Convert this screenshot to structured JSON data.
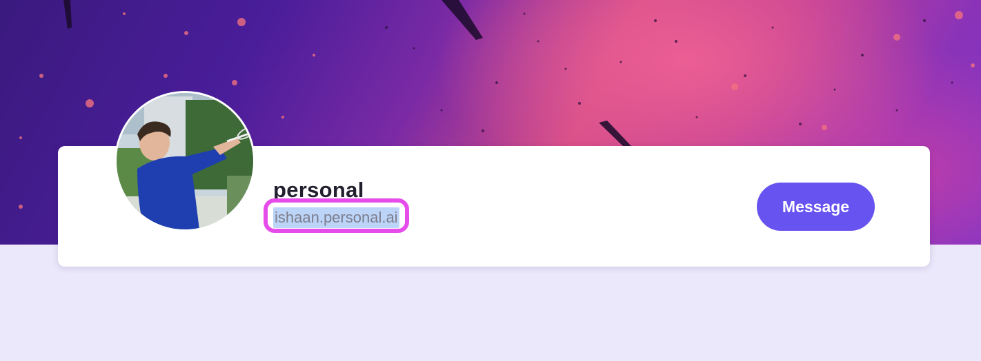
{
  "profile": {
    "name": "personal",
    "handle": "ishaan.personal.ai",
    "avatar_icon": "profile-photo-tennis-player"
  },
  "actions": {
    "message_label": "Message"
  },
  "colors": {
    "accent": "#6753f0",
    "highlight_outline": "#e64ce9",
    "text_selection": "#bcd4f7",
    "page_background": "#ece8fb"
  }
}
